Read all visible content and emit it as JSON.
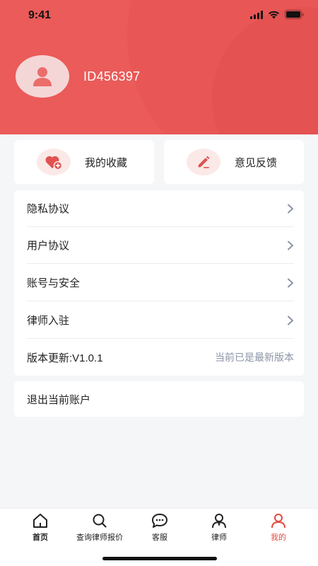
{
  "status_bar": {
    "time": "9:41"
  },
  "profile": {
    "user_id": "ID456397"
  },
  "quick_actions": [
    {
      "label": "我的收藏",
      "icon": "heart-plus-icon"
    },
    {
      "label": "意见反馈",
      "icon": "pencil-icon"
    }
  ],
  "menu": {
    "items": [
      {
        "label": "隐私协议"
      },
      {
        "label": "用户协议"
      },
      {
        "label": "账号与安全"
      },
      {
        "label": "律师入驻"
      }
    ],
    "version": {
      "label": "版本更新:V1.0.1",
      "status": "当前已是最新版本"
    }
  },
  "logout": {
    "label": "退出当前账户"
  },
  "tabbar": {
    "tabs": [
      {
        "label": "首页",
        "icon": "home-icon"
      },
      {
        "label": "查询律师报价",
        "icon": "search-icon"
      },
      {
        "label": "客服",
        "icon": "chat-icon"
      },
      {
        "label": "律师",
        "icon": "lawyer-icon"
      },
      {
        "label": "我的",
        "icon": "person-icon"
      }
    ],
    "active_index": 4
  },
  "colors": {
    "brand": "#ea5b59",
    "accent": "#e5493f",
    "muted_text": "#8c94a6",
    "background": "#f5f6f8"
  }
}
